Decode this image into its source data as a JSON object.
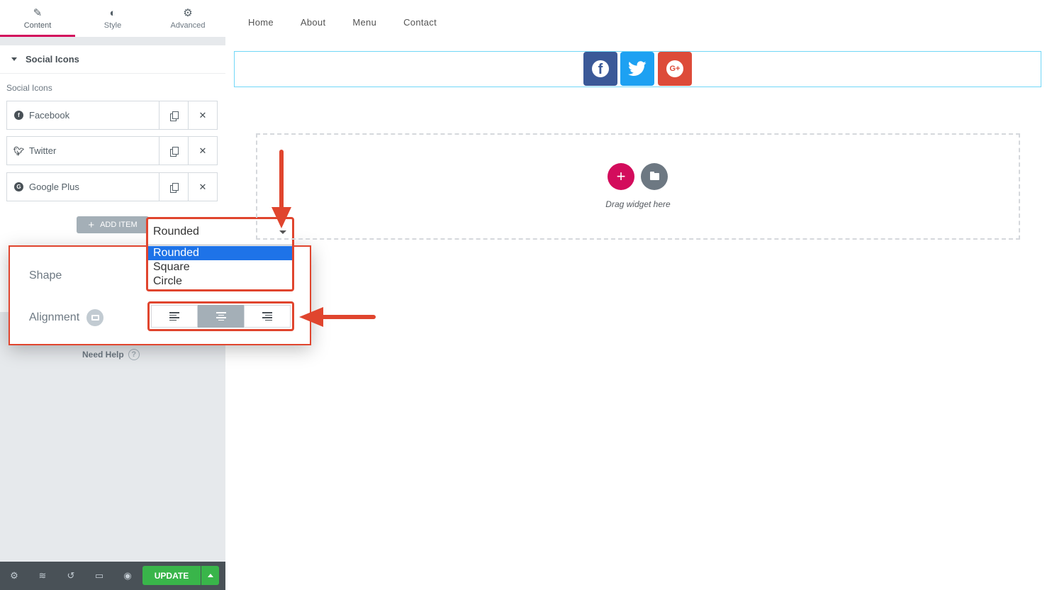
{
  "tabs": [
    {
      "label": "Content",
      "icon": "pencil-icon",
      "active": true
    },
    {
      "label": "Style",
      "icon": "contrast-icon",
      "active": false
    },
    {
      "label": "Advanced",
      "icon": "gear-icon",
      "active": false
    }
  ],
  "section": {
    "title": "Social Icons"
  },
  "repeater": {
    "label": "Social Icons",
    "items": [
      {
        "label": "Facebook",
        "icon": "facebook-icon"
      },
      {
        "label": "Twitter",
        "icon": "twitter-icon"
      },
      {
        "label": "Google Plus",
        "icon": "google-plus-icon"
      }
    ],
    "add_item_label": "ADD ITEM"
  },
  "shape": {
    "label": "Shape",
    "selected": "Rounded",
    "options": [
      "Rounded",
      "Square",
      "Circle"
    ]
  },
  "alignment": {
    "label": "Alignment",
    "options": [
      "left",
      "center",
      "right"
    ],
    "active": "center"
  },
  "help": {
    "label": "Need Help",
    "glyph": "?"
  },
  "bottom_bar": {
    "update_label": "UPDATE"
  },
  "preview": {
    "nav": [
      "Home",
      "About",
      "Menu",
      "Contact"
    ],
    "social_icons": [
      {
        "network": "facebook",
        "color": "#3b5998"
      },
      {
        "network": "twitter",
        "color": "#1da1f2"
      },
      {
        "network": "google-plus",
        "color": "#dd4b39",
        "glyph": "G+"
      }
    ],
    "drop_zone_text": "Drag widget here"
  },
  "colors": {
    "accent": "#d30c5c",
    "highlight": "#e0452e",
    "update_green": "#39b54a",
    "select_blue": "#1e73e8"
  }
}
